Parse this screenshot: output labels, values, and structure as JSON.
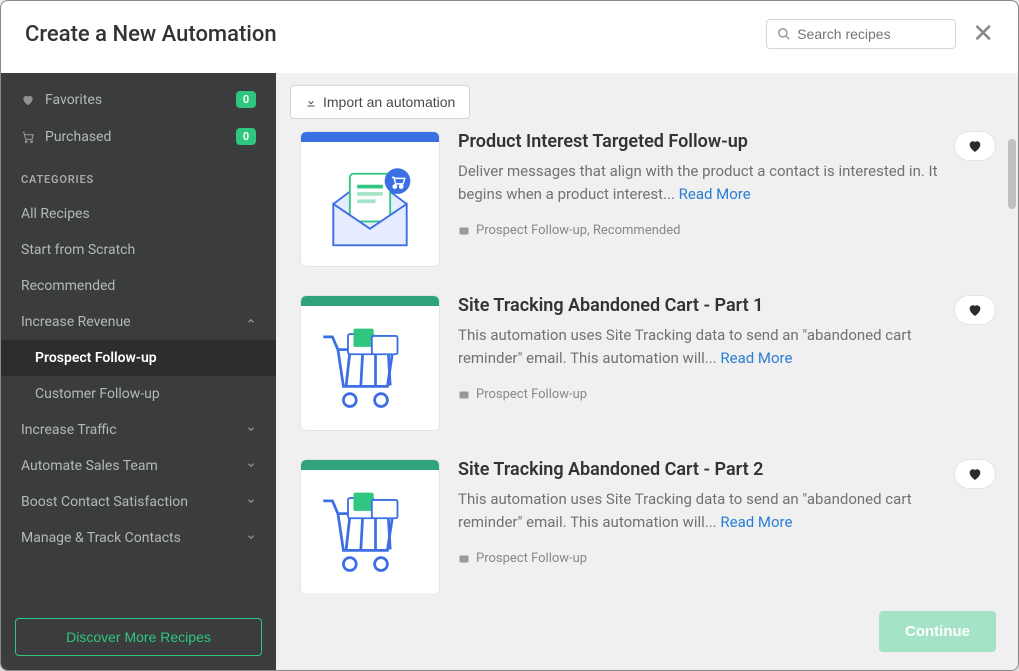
{
  "header": {
    "title": "Create a New Automation",
    "search_placeholder": "Search recipes"
  },
  "sidebar": {
    "favorites": {
      "label": "Favorites",
      "count": "0"
    },
    "purchased": {
      "label": "Purchased",
      "count": "0"
    },
    "categories_label": "CATEGORIES",
    "all_recipes": "All Recipes",
    "start_scratch": "Start from Scratch",
    "recommended": "Recommended",
    "increase_revenue": {
      "label": "Increase Revenue",
      "sub": [
        "Prospect Follow-up",
        "Customer Follow-up"
      ]
    },
    "increase_traffic": "Increase Traffic",
    "automate_sales": "Automate Sales Team",
    "boost_contact": "Boost Contact Satisfaction",
    "manage_track": "Manage & Track Contacts",
    "discover_label": "Discover More Recipes"
  },
  "toolbar": {
    "import_label": "Import an automation"
  },
  "recipes": [
    {
      "title": "Product Interest Targeted Follow-up",
      "desc": "Deliver messages that align with the product a contact is interested in. It begins when a product interest... ",
      "read_more": "Read More",
      "tags": "Prospect Follow-up, Recommended",
      "accent": "blue",
      "icon": "envelope"
    },
    {
      "title": "Site Tracking Abandoned Cart - Part 1",
      "desc": "This automation uses Site Tracking data to send an \"abandoned cart reminder\" email. This automation will... ",
      "read_more": "Read More",
      "tags": "Prospect Follow-up",
      "accent": "green",
      "icon": "cart"
    },
    {
      "title": "Site Tracking Abandoned Cart - Part 2",
      "desc": "This automation uses Site Tracking data to send an \"abandoned cart reminder\" email. This automation will... ",
      "read_more": "Read More",
      "tags": "Prospect Follow-up",
      "accent": "green",
      "icon": "cart"
    }
  ],
  "footer": {
    "continue_label": "Continue"
  }
}
